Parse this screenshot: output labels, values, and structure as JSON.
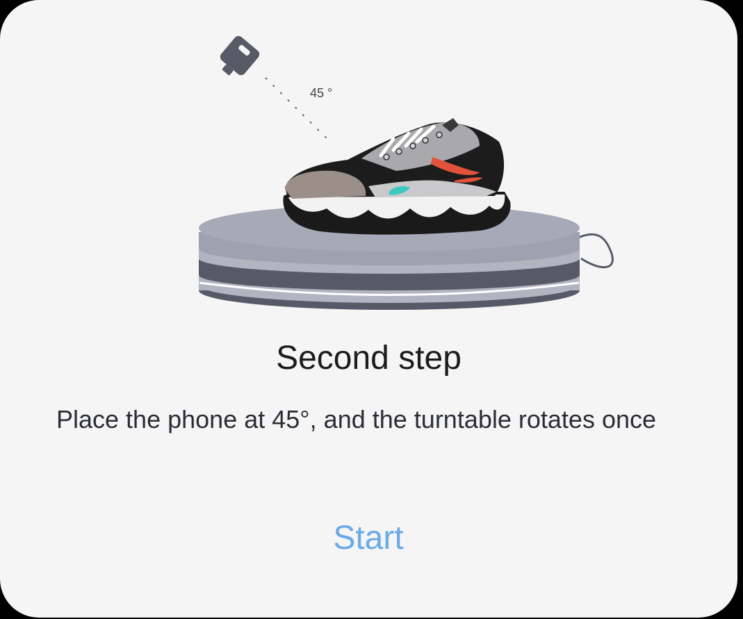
{
  "illustration": {
    "angle_label": "45 °",
    "icons": [
      "phone-icon",
      "sneaker-icon",
      "turntable-icon"
    ]
  },
  "dialog": {
    "title": "Second step",
    "description": "Place the phone at 45°, and the turntable rotates once",
    "start_label": "Start"
  },
  "colors": {
    "background": "#f5f5f5",
    "title_text": "#1c1c1e",
    "body_text": "#2b2d36",
    "accent": "#6aaae6",
    "turntable_top": "#a6a9b6",
    "turntable_dark": "#565a66"
  }
}
